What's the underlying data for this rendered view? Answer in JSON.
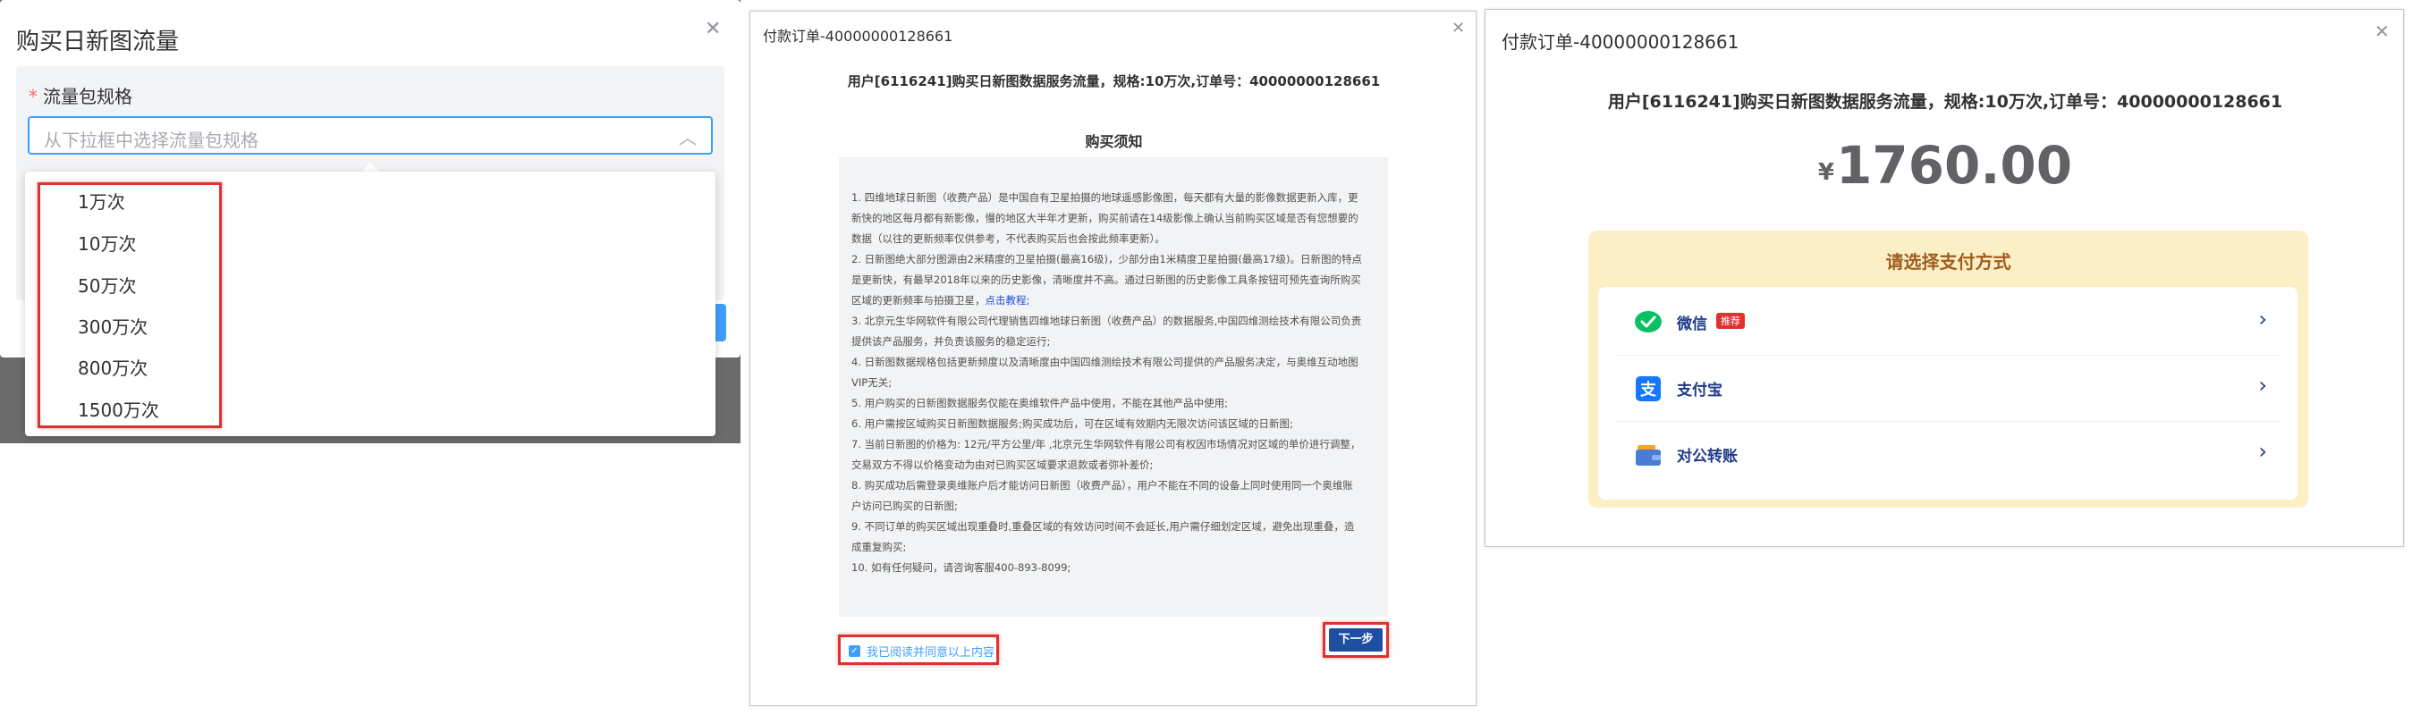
{
  "panel1": {
    "title": "购买日新图流量",
    "field_label": "流量包规格",
    "required_mark": "*",
    "select_placeholder": "从下拉框中选择流量包规格",
    "options": [
      "1万次",
      "10万次",
      "50万次",
      "300万次",
      "800万次",
      "1500万次"
    ]
  },
  "panel2": {
    "title": "付款订单-40000000128661",
    "headline": "用户[6116241]购买日新图数据服务流量，规格:10万次,订单号：40000000128661",
    "notice_title": "购买须知",
    "notice_items": [
      "1. 四维地球日新图（收费产品）是中国自有卫星拍摄的地球遥感影像图，每天都有大量的影像数据更新入库，更新快的地区每月都有新影像，慢的地区大半年才更新，购买前请在14级影像上确认当前购买区域是否有您想要的数据（以往的更新频率仅供参考，不代表购买后也会按此频率更新）。",
      "2. 日新图绝大部分图源由2米精度的卫星拍摄(最高16级)，少部分由1米精度卫星拍摄(最高17级)。日新图的特点是更新快，有最早2018年以来的历史影像，清晰度并不高。通过日新图的历史影像工具条按钮可预先查询所购买区域的更新频率与拍摄卫星，",
      "3. 北京元生华网软件有限公司代理销售四维地球日新图（收费产品）的数据服务,中国四维测绘技术有限公司负责提供该产品服务，并负责该服务的稳定运行;",
      "4. 日新图数据规格包括更新频度以及清晰度由中国四维测绘技术有限公司提供的产品服务决定，与奥维互动地图VIP无关;",
      "5. 用户购买的日新图数据服务仅能在奥维软件产品中使用，不能在其他产品中使用;",
      "6. 用户需按区域购买日新图数据服务;购买成功后，可在区域有效期内无限次访问该区域的日新图;",
      "7. 当前日新图的价格为: 12元/平方公里/年 ,北京元生华网软件有限公司有权因市场情况对区域的单价进行调整，交易双方不得以价格变动为由对已购买区域要求退款或者弥补差价;",
      "8. 购买成功后需登录奥维账户后才能访问日新图（收费产品），用户不能在不同的设备上同时使用同一个奥维账户访问已购买的日新图;",
      "9. 不同订单的购买区域出现重叠时,重叠区域的有效访问时间不会延长,用户需仔细划定区域，避免出现重叠，造成重复购买;",
      "10. 如有任何疑问，请咨询客服400-893-8099;"
    ],
    "tutorial_link": "点击教程;",
    "agree_label": "我已阅读并同意以上内容",
    "next_label": "下一步"
  },
  "panel3": {
    "title": "付款订单-40000000128661",
    "headline": "用户[6116241]购买日新图数据服务流量，规格:10万次,订单号：40000000128661",
    "currency": "¥",
    "amount": "1760.00",
    "pay_title": "请选择支付方式",
    "methods": [
      {
        "name": "微信",
        "badge": "推荐",
        "icon": "wechat-icon",
        "color": "#07c160"
      },
      {
        "name": "支付宝",
        "badge": "",
        "icon": "alipay-icon",
        "color": "#1677ff"
      },
      {
        "name": "对公转账",
        "badge": "",
        "icon": "wallet-icon",
        "color": "#4a7bd6"
      }
    ]
  },
  "colors": {
    "accent": "#409eff",
    "highlight": "#e03131",
    "primary_button": "#1e4fa3",
    "pay_panel": "#fcefc6"
  }
}
